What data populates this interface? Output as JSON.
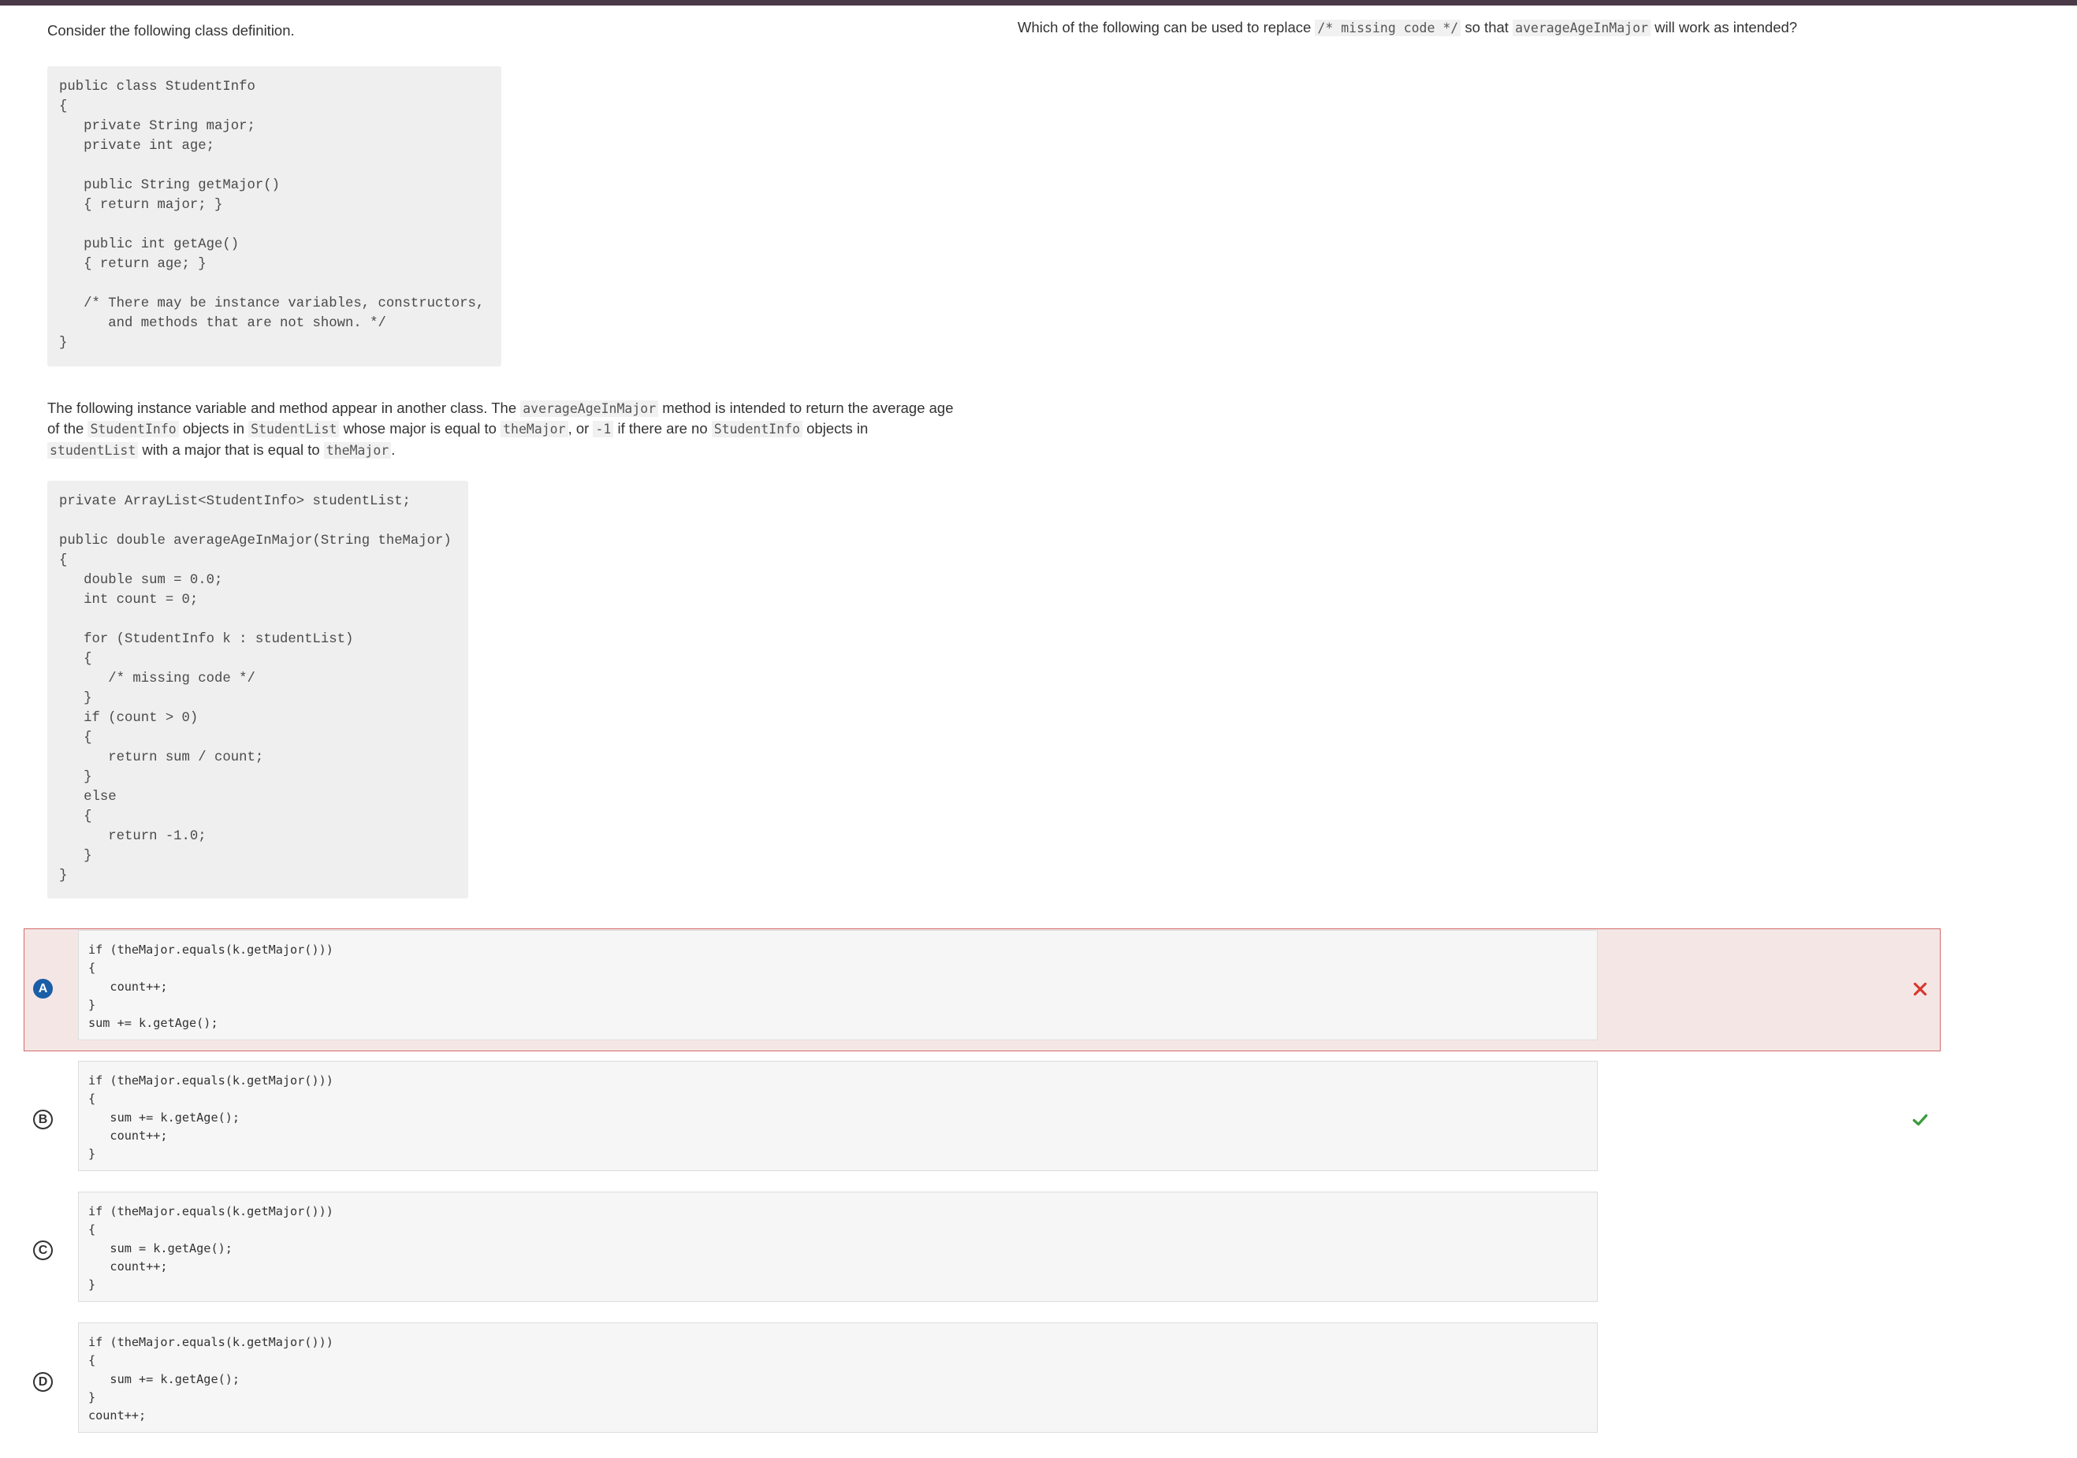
{
  "intro": "Consider the following class definition.",
  "class_code": "public class StudentInfo\n{\n   private String major;\n   private int age;\n\n   public String getMajor()\n   { return major; }\n\n   public int getAge()\n   { return age; }\n\n   /* There may be instance variables, constructors,\n      and methods that are not shown. */\n}",
  "para2": {
    "t1": "The following instance variable and method appear in another class. The ",
    "c1": "averageAgeInMajor",
    "t2": " method is intended to return the average age of the ",
    "c2": "StudentInfo",
    "t3": " objects in ",
    "c3": "StudentList",
    "t4": " whose major is equal to ",
    "c4": "theMajor",
    "t5": ", or ",
    "c5": "-1",
    "t6": " if there are no ",
    "c6": "StudentInfo",
    "t7": " objects in ",
    "c7": "studentList",
    "t8": " with a major that is equal to ",
    "c8": "theMajor",
    "t9": "."
  },
  "method_code": "private ArrayList<StudentInfo> studentList;\n\npublic double averageAgeInMajor(String theMajor)\n{\n   double sum = 0.0;\n   int count = 0;\n\n   for (StudentInfo k : studentList)\n   {\n      /* missing code */\n   }\n   if (count > 0)\n   {\n      return sum / count;\n   }\n   else\n   {\n      return -1.0;\n   }\n}",
  "question": {
    "t1": "Which of the following can be used to replace ",
    "c1": "/* missing code */",
    "t2": " so that ",
    "c2": "averageAgeInMajor",
    "t3": " will work as intended?"
  },
  "options": [
    {
      "letter": "A",
      "code": "if (theMajor.equals(k.getMajor()))\n{\n   count++;\n}\nsum += k.getAge();",
      "status": "selected-incorrect"
    },
    {
      "letter": "B",
      "code": "if (theMajor.equals(k.getMajor()))\n{\n   sum += k.getAge();\n   count++;\n}",
      "status": "correct"
    },
    {
      "letter": "C",
      "code": "if (theMajor.equals(k.getMajor()))\n{\n   sum = k.getAge();\n   count++;\n}",
      "status": "none"
    },
    {
      "letter": "D",
      "code": "if (theMajor.equals(k.getMajor()))\n{\n   sum += k.getAge();\n}\ncount++;",
      "status": "none"
    }
  ],
  "colors": {
    "header_bar": "#4a3946",
    "selected_badge": "#1a5ea8",
    "incorrect_bg": "#f5e6e6",
    "incorrect_border": "#d46a6a",
    "incorrect_mark": "#d9362b",
    "correct_mark": "#3c9b3c"
  }
}
